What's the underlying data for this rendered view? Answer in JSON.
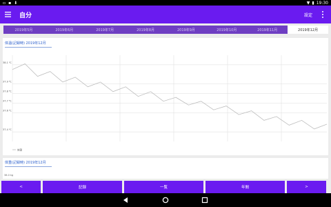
{
  "status": {
    "time": "19:30"
  },
  "appbar": {
    "title": "自分",
    "settings_label": "設定"
  },
  "tabs": [
    "2019年5月",
    "2019年6月",
    "2019年7月",
    "2019年8月",
    "2019年9月",
    "2019年10月",
    "2019年11月",
    "2019年12月"
  ],
  "active_tab": 7,
  "card1": {
    "title": "体温(記録時) 2019年12月"
  },
  "card2": {
    "title": "体重(記録時) 2019年12月",
    "partial_tick": "38.0 kg"
  },
  "bottom": {
    "prev": "<",
    "record": "記録",
    "list": "一覧",
    "annual": "年間",
    "next": ">"
  },
  "chart_data": {
    "type": "line",
    "title": "体温(記録時) 2019年12月",
    "y_ticks": [
      "38.1 ℃",
      "37.9 ℃",
      "37.8 ℃",
      "37.7 ℃",
      "37.6 ℃",
      "37.4 ℃"
    ],
    "y_tick_values": [
      38.1,
      37.9,
      37.8,
      37.7,
      37.6,
      37.4
    ],
    "ylim": [
      37.3,
      38.2
    ],
    "grid": true,
    "legend_position": "bottom-left",
    "series": [
      {
        "name": "体温",
        "color": "#bdbdbd",
        "values": [
          38.05,
          38.11,
          37.98,
          38.03,
          37.92,
          37.97,
          37.87,
          37.92,
          37.82,
          37.87,
          37.77,
          37.82,
          37.72,
          37.76,
          37.68,
          37.72,
          37.63,
          37.67,
          37.58,
          37.62,
          37.52,
          37.56,
          37.47,
          37.52,
          37.43,
          37.48
        ]
      }
    ]
  }
}
